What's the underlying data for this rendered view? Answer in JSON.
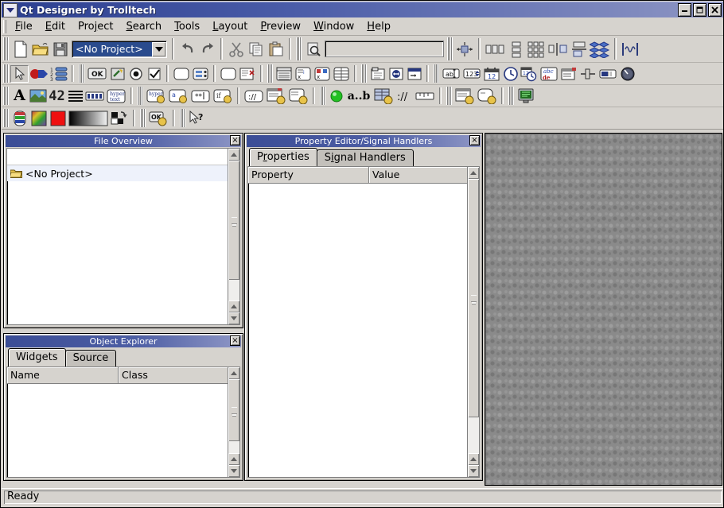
{
  "window": {
    "title": "Qt Designer by Trolltech",
    "app_icon": "qt-logo-icon",
    "buttons": {
      "minimize": "minimize-button",
      "maximize": "maximize-button",
      "close": "close-button"
    }
  },
  "menubar": {
    "items": [
      {
        "label": "File",
        "mnemonic": "F"
      },
      {
        "label": "Edit",
        "mnemonic": "E"
      },
      {
        "label": "Project",
        "mnemonic": "j"
      },
      {
        "label": "Search",
        "mnemonic": "S"
      },
      {
        "label": "Tools",
        "mnemonic": "T"
      },
      {
        "label": "Layout",
        "mnemonic": "L"
      },
      {
        "label": "Preview",
        "mnemonic": "P"
      },
      {
        "label": "Window",
        "mnemonic": "W"
      },
      {
        "label": "Help",
        "mnemonic": "H"
      }
    ]
  },
  "toolbars": {
    "file_row": {
      "new": "new-file-icon",
      "open": "open-folder-icon",
      "save": "save-disk-icon",
      "project_combo_value": "<No Project>",
      "undo": "undo-arrow-icon",
      "redo": "redo-arrow-icon",
      "cut": "scissors-icon",
      "copy": "copy-icon",
      "paste": "paste-icon",
      "search": "search-page-icon",
      "search_field_value": ""
    },
    "layout_row": {
      "adjust_size": "adjust-size-icon",
      "lay_out_horizontally": "layout-horizontal-icon",
      "lay_out_vertically": "layout-vertical-icon",
      "lay_out_grid": "layout-grid-icon",
      "split_horizontal": "split-horizontal-icon",
      "split_vertical": "split-vertical-icon",
      "break_layout": "break-layout-icon",
      "add_spacer": "spacer-icon"
    },
    "tools_row": {
      "pointer": "pointer-arrow-icon",
      "connect_signals": "connect-signals-icon",
      "tab_order": "tab-order-icon",
      "push_button": "push-button-icon",
      "tool_button": "tool-button-icon",
      "radio_button": "radio-button-icon",
      "check_box": "check-box-icon",
      "group_box": "group-box-icon",
      "button_group": "button-group-icon",
      "frame": "frame-icon",
      "widget_stack": "widget-stack-icon",
      "list_view": "list-view-icon",
      "list_box": "list-box-icon",
      "icon_view": "icon-view-icon",
      "table": "table-icon",
      "tab_widget": "tab-widget-icon",
      "splitter": "splitter-icon",
      "wizard": "wizard-icon",
      "line_edit": "line-edit-icon",
      "spin_box": "spin-box-icon",
      "date_edit": "date-edit-icon",
      "time_edit": "time-edit-icon",
      "date_time_edit": "date-time-edit-icon",
      "text_edit": "text-edit-icon",
      "combo_box": "combo-box-icon",
      "slider": "slider-icon",
      "progress_bar": "progress-bar-icon",
      "dial": "dial-icon"
    },
    "display_row": {
      "text_label": "text-label-icon",
      "pixmap_label": "pixmap-label-icon",
      "lcd_number": "lcd-number-icon",
      "line": "line-icon",
      "progress": "progress-icon",
      "text_browser": "text-browser-icon",
      "custom_browser": "custom-browser-icon",
      "custom_action": "custom-action-icon",
      "custom_widget_a": "custom-widget-a-icon",
      "custom_widget_b": "custom-widget-b-icon",
      "comment": "comment-icon",
      "custom_dialog": "custom-dialog-icon",
      "custom_form": "custom-form-icon",
      "led_indicator": "led-green-icon",
      "range_label": "a..b",
      "custom_table": "custom-table-icon",
      "url_icon": "url-icon",
      "ruler": "ruler-icon",
      "custom_window": "custom-window-icon",
      "custom_round": "custom-round-icon",
      "preview_form": "preview-form-icon"
    },
    "color_row": {
      "palette_editor": "palette-editor-icon",
      "color_spectrum": "color-spectrum-icon",
      "solid_color": "solid-red-icon",
      "grayscale_gradient": "grayscale-gradient-icon",
      "swap_colors": "swap-colors-icon",
      "custom_ok": "custom-ok-icon",
      "whats_this": "whats-this-icon"
    }
  },
  "file_overview": {
    "title": "File Overview",
    "close": "×",
    "tree": [
      {
        "label": "<No Project>",
        "icon": "folder-icon"
      }
    ]
  },
  "object_explorer": {
    "title": "Object Explorer",
    "close": "×",
    "tabs": [
      {
        "label": "Widgets",
        "active": true
      },
      {
        "label": "Source",
        "active": false
      }
    ],
    "columns": [
      "Name",
      "Class"
    ],
    "rows": []
  },
  "property_editor": {
    "title": "Property Editor/Signal Handlers",
    "close": "×",
    "tabs": [
      {
        "label": "Properties",
        "mnemonic": "r",
        "active": true
      },
      {
        "label": "Signal Handlers",
        "mnemonic": "i",
        "active": false
      }
    ],
    "columns": [
      "Property",
      "Value"
    ],
    "rows": []
  },
  "workspace": {
    "name": "mdi-workspace",
    "background": "#8a8a8a"
  },
  "statusbar": {
    "message": "Ready"
  },
  "colors": {
    "face": "#d6d3ce",
    "titlebar_start": "#2c3f8f",
    "titlebar_end": "#8e96c4",
    "highlight": "#2a4b8d",
    "workspace": "#8a8a8a"
  }
}
